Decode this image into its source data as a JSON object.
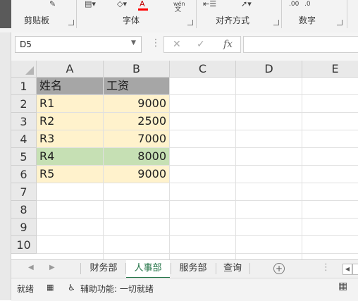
{
  "ribbon": {
    "groups": [
      {
        "label": "剪贴板"
      },
      {
        "label": "字体"
      },
      {
        "label": "对齐方式"
      },
      {
        "label": "数字"
      }
    ],
    "font_color_letter": "A",
    "wen_label": "wén",
    "wen_char": "文",
    "num_format_left": ".00",
    "num_format_right": ".0"
  },
  "formula_bar": {
    "name_box": "D5",
    "formula": ""
  },
  "columns": [
    "A",
    "B",
    "C",
    "D",
    "E"
  ],
  "rows": [
    "1",
    "2",
    "3",
    "4",
    "5",
    "6",
    "7",
    "8",
    "9",
    "10"
  ],
  "table": {
    "headers": [
      "姓名",
      "工资"
    ],
    "records": [
      {
        "name": "R1",
        "salary": "9000"
      },
      {
        "name": "R2",
        "salary": "2500"
      },
      {
        "name": "R3",
        "salary": "7000"
      },
      {
        "name": "R4",
        "salary": "8000"
      },
      {
        "name": "R5",
        "salary": "9000"
      }
    ]
  },
  "sheet_tabs": [
    {
      "label": "财务部",
      "active": false
    },
    {
      "label": "人事部",
      "active": true
    },
    {
      "label": "服务部",
      "active": false
    },
    {
      "label": "查询",
      "active": false
    }
  ],
  "status": {
    "ready": "就绪",
    "accessibility": "辅助功能: 一切就绪"
  },
  "colors": {
    "header_fill": "#a6a6a6",
    "row_fill": "#fff2cc",
    "highlight_fill": "#c6e0b4",
    "accent": "#217346"
  }
}
